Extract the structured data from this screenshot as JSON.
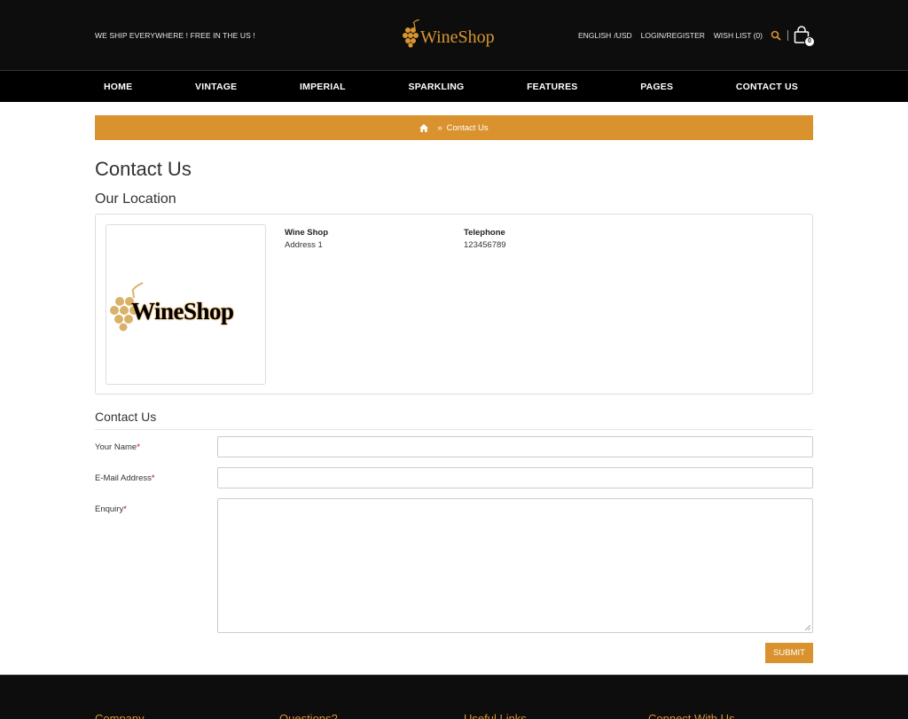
{
  "header": {
    "ship_text": "WE SHIP EVERYWHERE ! FREE IN THE US !",
    "logo_text": "WineShop",
    "links": [
      "ENGLISH",
      "/USD",
      "LOGIN",
      "/REGISTER",
      "WISH LIST (0)"
    ],
    "cart_count": "0",
    "accent_color": "#d9922e"
  },
  "nav": {
    "items": [
      "HOME",
      "VINTAGE",
      "IMPERIAL",
      "SPARKLING",
      "FEATURES",
      "PAGES",
      "CONTACT US"
    ]
  },
  "breadcrumb": {
    "separator": "»",
    "current": "Contact Us"
  },
  "main": {
    "page_title": "Contact Us",
    "location_title": "Our Location",
    "location": {
      "image_logo_text": "WineShop",
      "store_name": "Wine Shop",
      "address": "Address 1",
      "telephone_label": "Telephone",
      "telephone": "123456789"
    },
    "contact_title": "Contact Us",
    "form": {
      "name_label": "Your Name",
      "email_label": "E-Mail Address",
      "enquiry_label": "Enquiry",
      "required_marker": "*",
      "name_value": "",
      "email_value": "",
      "enquiry_value": "",
      "submit_label": "SUBMIT"
    }
  },
  "footer": {
    "headings": [
      "Company",
      "Questions?",
      "Useful Links",
      "Connect With Us"
    ]
  }
}
